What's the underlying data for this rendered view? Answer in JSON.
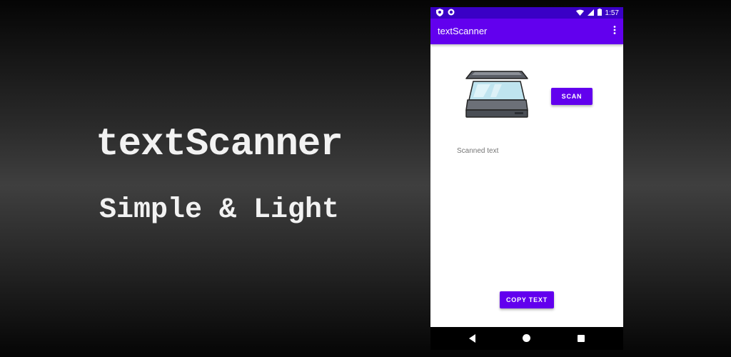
{
  "promo": {
    "title": "textScanner",
    "subtitle": "Simple & Light"
  },
  "status_bar": {
    "time": "1:57",
    "icons": [
      "shield-icon",
      "circle-icon",
      "wifi-icon",
      "signal-icon",
      "battery-icon"
    ]
  },
  "app_bar": {
    "title": "textScanner",
    "menu_icon": "more-vert-icon"
  },
  "main": {
    "scan_label": "SCAN",
    "scanned_text": "Scanned text",
    "copy_label": "COPY TEXT"
  },
  "nav_bar": {
    "icons": [
      "back-icon",
      "home-icon",
      "recents-icon"
    ]
  },
  "colors": {
    "primary": "#6200ee",
    "primary_dark": "#3a00c6",
    "text_secondary": "#757575"
  }
}
